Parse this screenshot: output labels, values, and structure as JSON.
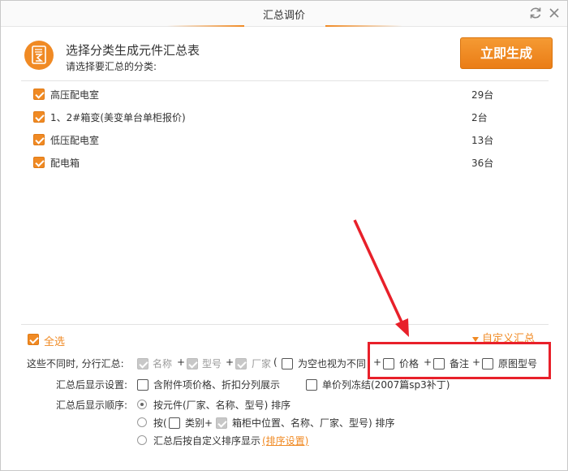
{
  "window": {
    "title": "汇总调价"
  },
  "header": {
    "title": "选择分类生成元件汇总表",
    "subtitle": "请选择要汇总的分类:",
    "generate_label": "立即生成"
  },
  "categories": [
    {
      "label": "高压配电室",
      "count": "29台",
      "checked": true
    },
    {
      "label": "1、2#箱变(美变单台单柜报价)",
      "count": "2台",
      "checked": true
    },
    {
      "label": "低压配电室",
      "count": "13台",
      "checked": true
    },
    {
      "label": "配电箱",
      "count": "36台",
      "checked": true
    }
  ],
  "select_all": {
    "label": "全选",
    "checked": true
  },
  "custom_summary": {
    "label": "自定义汇总"
  },
  "group_by": {
    "label": "这些不同时, 分行汇总:",
    "options": {
      "name": "名称",
      "model": "型号",
      "vendor": "厂家",
      "empty_as_diff": "为空也视为不同",
      "price": "价格",
      "remark": "备注",
      "orig_model": "原图型号"
    },
    "plus": "+",
    "paren_open": "(",
    "paren_close": ")"
  },
  "display_settings": {
    "label": "汇总后显示设置:",
    "opt1": "含附件项价格、折扣分列展示",
    "opt2": "单价列冻结(2007篇sp3补丁)"
  },
  "display_order": {
    "label": "汇总后显示顺序:",
    "opt1": "按元件(厂家、名称、型号) 排序",
    "opt2_prefix": "按(",
    "opt2_category": "类别+",
    "opt2_rest": "箱柜中位置、名称、厂家、型号) 排序",
    "opt3": "汇总后按自定义排序显示",
    "opt3_link": "(排序设置)"
  },
  "colors": {
    "accent": "#f08a24",
    "annotation": "#e8202a"
  }
}
